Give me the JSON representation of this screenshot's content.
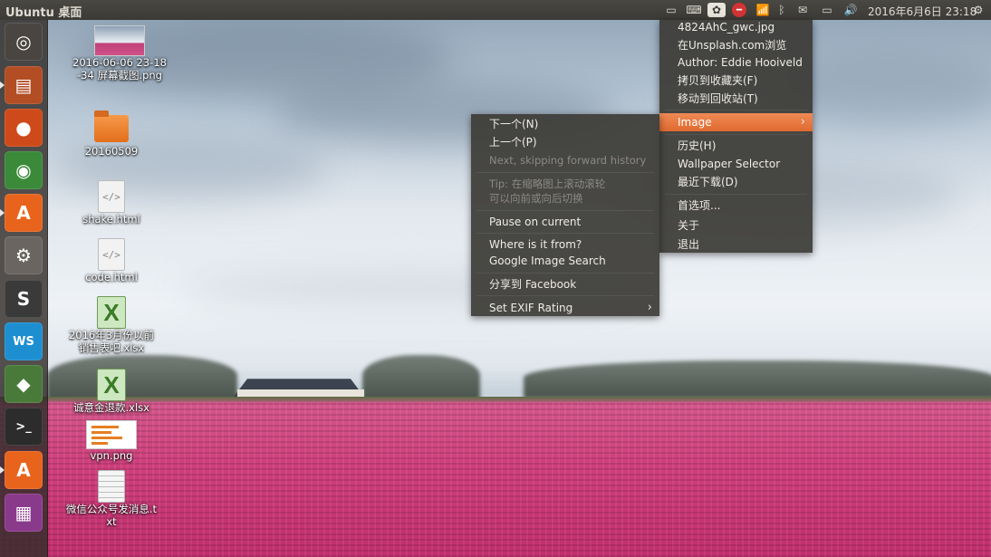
{
  "top_panel": {
    "title": "Ubuntu 桌面",
    "clock": "2016年6月6日 23:18"
  },
  "launcher": {
    "items": [
      {
        "name": "ubuntu-dash-icon",
        "glyph": "◎",
        "bg": "#4a4540"
      },
      {
        "name": "files-icon",
        "glyph": "▤",
        "bg": "#b24d24"
      },
      {
        "name": "firefox-icon",
        "glyph": "●",
        "bg": "#cf4a1a"
      },
      {
        "name": "chrome-icon",
        "glyph": "◉",
        "bg": "#3a8a3a"
      },
      {
        "name": "software-center-icon",
        "glyph": "A",
        "bg": "#e8641c"
      },
      {
        "name": "system-settings-icon",
        "glyph": "⚙",
        "bg": "#6a6560"
      },
      {
        "name": "sublime-text-icon",
        "glyph": "S",
        "bg": "#3a3a3a"
      },
      {
        "name": "webstorm-icon",
        "glyph": "WS",
        "bg": "#1d8fd1"
      },
      {
        "name": "android-icon",
        "glyph": "◆",
        "bg": "#4a7a3a"
      },
      {
        "name": "terminal-icon",
        "glyph": ">_",
        "bg": "#2c2c2c"
      },
      {
        "name": "software-updater-icon",
        "glyph": "A",
        "bg": "#e8641c"
      },
      {
        "name": "workspace-switcher-icon",
        "glyph": "▦",
        "bg": "#8a3a8a"
      }
    ]
  },
  "desktop_icons": [
    {
      "label": "2016-06-06 23-18-34 屏幕截图.png",
      "type": "thumb"
    },
    {
      "label": "20160509",
      "type": "folder"
    },
    {
      "label": "shake.html",
      "type": "html"
    },
    {
      "label": "code.html",
      "type": "html"
    },
    {
      "label": "2016年3月份以前销售表吧.xlsx",
      "type": "xlsx"
    },
    {
      "label": "诚意金退款.xlsx",
      "type": "xlsx"
    },
    {
      "label": "vpn.png",
      "type": "thumb2"
    },
    {
      "label": "微信公众号发消息.txt",
      "type": "txt"
    }
  ],
  "variety_menu": {
    "items": [
      {
        "label": "4824AhC_gwc.jpg",
        "state": "normal"
      },
      {
        "label": "在Unsplash.com浏览",
        "state": "normal"
      },
      {
        "label": "Author: Eddie Hooiveld",
        "state": "normal"
      },
      {
        "label": "拷贝到收藏夹(F)",
        "state": "normal"
      },
      {
        "label": "移动到回收站(T)",
        "state": "normal"
      },
      {
        "label": "Image",
        "state": "active",
        "submenu": true
      },
      {
        "label": "历史(H)",
        "state": "normal"
      },
      {
        "label": "Wallpaper Selector",
        "state": "normal"
      },
      {
        "label": "最近下载(D)",
        "state": "normal"
      },
      {
        "label": "首选项...",
        "state": "normal"
      },
      {
        "label": "关于",
        "state": "normal"
      },
      {
        "label": "退出",
        "state": "normal"
      }
    ]
  },
  "image_submenu": {
    "items": [
      {
        "label": "下一个(N)",
        "state": "normal"
      },
      {
        "label": "上一个(P)",
        "state": "normal"
      },
      {
        "label": "Next, skipping forward history",
        "state": "disabled"
      },
      {
        "label": "Tip: 在缩略图上滚动滚轮",
        "state": "disabled"
      },
      {
        "label": "可以向前或向后切换",
        "state": "disabled"
      },
      {
        "label": "Pause on current",
        "state": "normal"
      },
      {
        "label": "Where is it from?",
        "state": "normal"
      },
      {
        "label": "Google Image Search",
        "state": "normal"
      },
      {
        "label": "分享到 Facebook",
        "state": "normal"
      },
      {
        "label": "Set EXIF Rating",
        "state": "normal",
        "submenu": true
      }
    ]
  },
  "colors": {
    "menu_bg": "#3c3b37",
    "menu_active": "#e06a30",
    "panel_bg": "#3b3a36"
  }
}
